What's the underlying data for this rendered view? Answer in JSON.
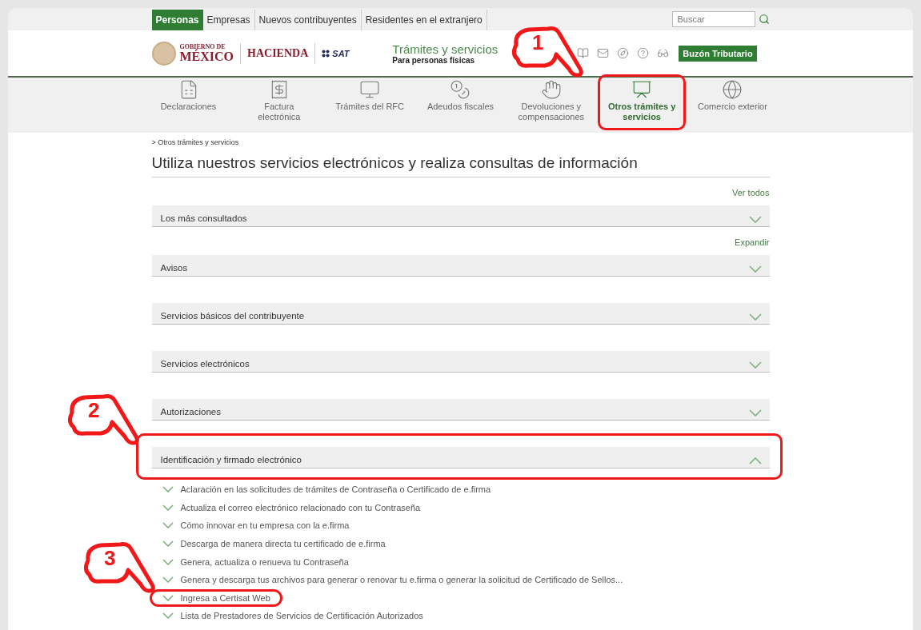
{
  "top_nav": {
    "tabs": [
      {
        "label": "Personas",
        "selected": true
      },
      {
        "label": "Empresas",
        "selected": false
      },
      {
        "label": "Nuevos contribuyentes",
        "selected": false
      },
      {
        "label": "Residentes en el extranjero",
        "selected": false
      }
    ],
    "search": {
      "placeholder": "Buscar"
    }
  },
  "header": {
    "logo_gobierno": {
      "line1": "GOBIERNO DE",
      "line2": "MÉXICO"
    },
    "logo_hacienda": "HACIENDA",
    "logo_sat": "SAT",
    "title": "Trámites y servicios",
    "subtitle": "Para personas físicas",
    "button": "Buzón Tributario"
  },
  "categories": [
    {
      "kind": "declaraciones",
      "label": "Declaraciones",
      "selected": false,
      "highlighted": false
    },
    {
      "kind": "factura",
      "label": "Factura electrónica",
      "selected": false,
      "highlighted": false
    },
    {
      "kind": "rfc",
      "label": "Trámites del RFC",
      "selected": false,
      "highlighted": false
    },
    {
      "kind": "adeudos",
      "label": "Adeudos fiscales",
      "selected": false,
      "highlighted": false
    },
    {
      "kind": "devoluciones",
      "label": "Devoluciones y compensaciones",
      "selected": false,
      "highlighted": false
    },
    {
      "kind": "otros",
      "label": "Otros trámites y servicios",
      "selected": true,
      "highlighted": true
    },
    {
      "kind": "comercio",
      "label": "Comercio exterior",
      "selected": false,
      "highlighted": false
    }
  ],
  "breadcrumb": "> Otros trámites y servicios",
  "heading": "Utiliza nuestros servicios electrónicos y realiza consultas de información",
  "sections": [
    {
      "action": "Ver todos",
      "title": "Los más consultados",
      "expanded": false,
      "highlighted": false
    },
    {
      "action": "Expandir",
      "title": "Avisos",
      "expanded": false,
      "highlighted": false
    },
    {
      "title": "Servicios básicos del contribuyente",
      "expanded": false,
      "highlighted": false
    },
    {
      "title": "Servicios electrónicos",
      "expanded": false,
      "highlighted": false
    },
    {
      "title": "Autorizaciones",
      "expanded": false,
      "highlighted": false
    },
    {
      "title": "Identificación y firmado electrónico",
      "expanded": true,
      "highlighted": true,
      "links": [
        {
          "label": "Aclaración en las solicitudes de trámites de Contraseña o Certificado de e.firma",
          "highlighted": false
        },
        {
          "label": "Actualiza el correo electrónico relacionado con tu Contraseña",
          "highlighted": false
        },
        {
          "label": "Cómo innovar en tu empresa con la e.firma",
          "highlighted": false
        },
        {
          "label": "Descarga de manera directa tu certificado de e.firma",
          "highlighted": false
        },
        {
          "label": "Genera, actualiza o renueva tu Contraseña",
          "highlighted": false
        },
        {
          "label": "Genera y descarga tus archivos para generar o renovar tu e.firma o generar la solicitud de Certificado de Sellos...",
          "highlighted": false
        },
        {
          "label": "Ingresa a Certisat Web",
          "highlighted": true
        },
        {
          "label": "Lista de Prestadores de Servicios de Certificación Autorizados",
          "highlighted": false
        }
      ]
    }
  ],
  "annotations": [
    {
      "number": "1"
    },
    {
      "number": "2"
    },
    {
      "number": "3"
    }
  ]
}
